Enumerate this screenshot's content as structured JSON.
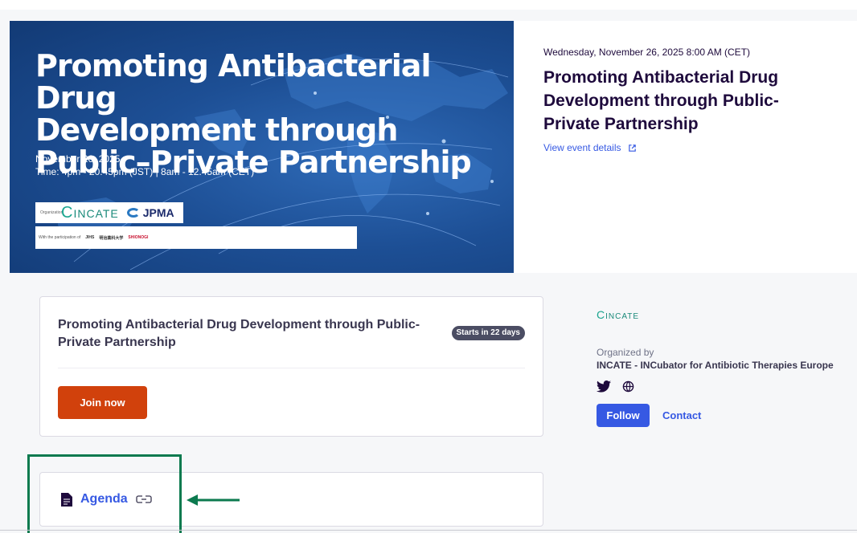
{
  "banner": {
    "title_line1": "Promoting Antibacterial Drug",
    "title_line2": "Development through",
    "title_line3": "Public–Private Partnership",
    "date": "November 26, 2025",
    "time": "Time: 4pm - 20.45pm (JST) | 8am - 12.45am (CET)",
    "org_label": "Organization",
    "org1": "INCATE",
    "org2": "JPMA",
    "partners_label": "With the participation of",
    "partners": [
      "SHIONOGI",
      "JIHS",
      "明治薬科大学"
    ]
  },
  "event": {
    "datetime": "Wednesday, November 26, 2025 8:00 AM (CET)",
    "title": "Promoting Antibacterial Drug Development through Public-Private Partnership",
    "view_details": "View event details"
  },
  "card": {
    "title": "Promoting Antibacterial Drug Development through Public-Private Partnership",
    "badge": "Starts in 22 days",
    "join_label": "Join now"
  },
  "organizer": {
    "logo": "INCATE",
    "organized_by": "Organized by",
    "name": "INCATE - INCubator for Antibiotic Therapies Europe",
    "follow_label": "Follow",
    "contact_label": "Contact"
  },
  "agenda": {
    "label": "Agenda"
  },
  "colors": {
    "brand_orange": "#d1410c",
    "link_blue": "#3659e3",
    "highlight_green": "#0c7a4f"
  }
}
